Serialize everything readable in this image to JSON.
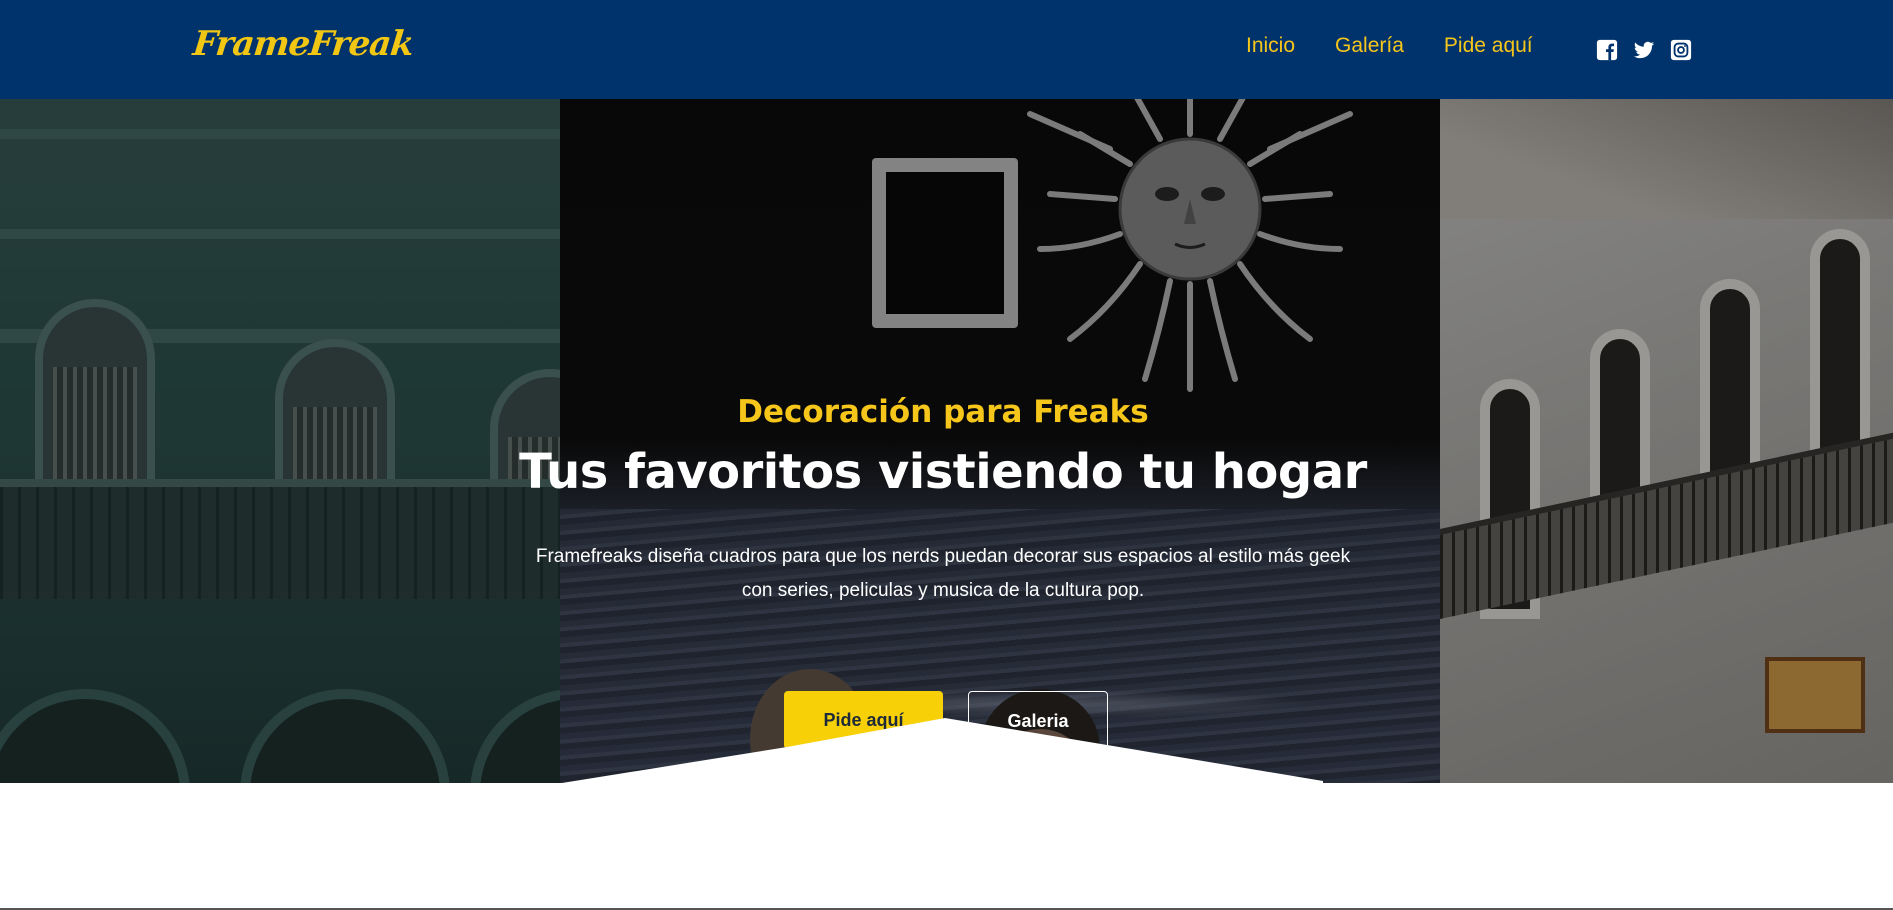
{
  "header": {
    "logo": "FrameFreak",
    "nav": [
      {
        "label": "Inicio"
      },
      {
        "label": "Galería"
      },
      {
        "label": "Pide aquí"
      }
    ],
    "social": [
      {
        "icon": "facebook-icon"
      },
      {
        "icon": "twitter-icon"
      },
      {
        "icon": "instagram-icon"
      }
    ],
    "colors": {
      "bg": "#00336b",
      "accent": "#f6c61b"
    }
  },
  "hero": {
    "subtitle": "Decoración para Freaks",
    "title": "Tus favoritos vistiendo tu hogar",
    "description": "Framefreaks diseña cuadros para que los nerds puedan decorar sus espacios al estilo más geek con series, peliculas y musica de la cultura pop.",
    "primary_button": "Pide aquí",
    "secondary_button": "Galeria",
    "colors": {
      "button": "#f7d007",
      "subtitle": "#f6c61b"
    }
  }
}
